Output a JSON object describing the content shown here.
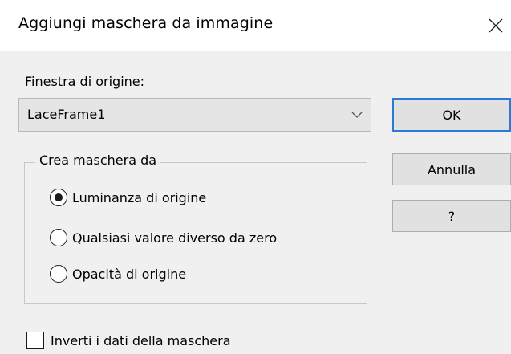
{
  "dialog": {
    "title": "Aggiungi maschera da immagine",
    "close_icon": "close-icon"
  },
  "source": {
    "label": "Finestra di origine:",
    "selected": "LaceFrame1",
    "dropdown_icon": "chevron-down-icon"
  },
  "buttons": {
    "ok": "OK",
    "cancel": "Annulla",
    "help": "?"
  },
  "mask_from": {
    "legend": "Crea maschera da",
    "options": [
      {
        "label": "Luminanza di origine",
        "selected": true
      },
      {
        "label": "Qualsiasi valore diverso da zero",
        "selected": false
      },
      {
        "label": "Opacità di origine",
        "selected": false
      }
    ]
  },
  "invert": {
    "label": "Inverti i dati della maschera",
    "checked": false
  },
  "colors": {
    "default_button_border": "#2a7ad6",
    "client_background": "#f0f0f0"
  }
}
